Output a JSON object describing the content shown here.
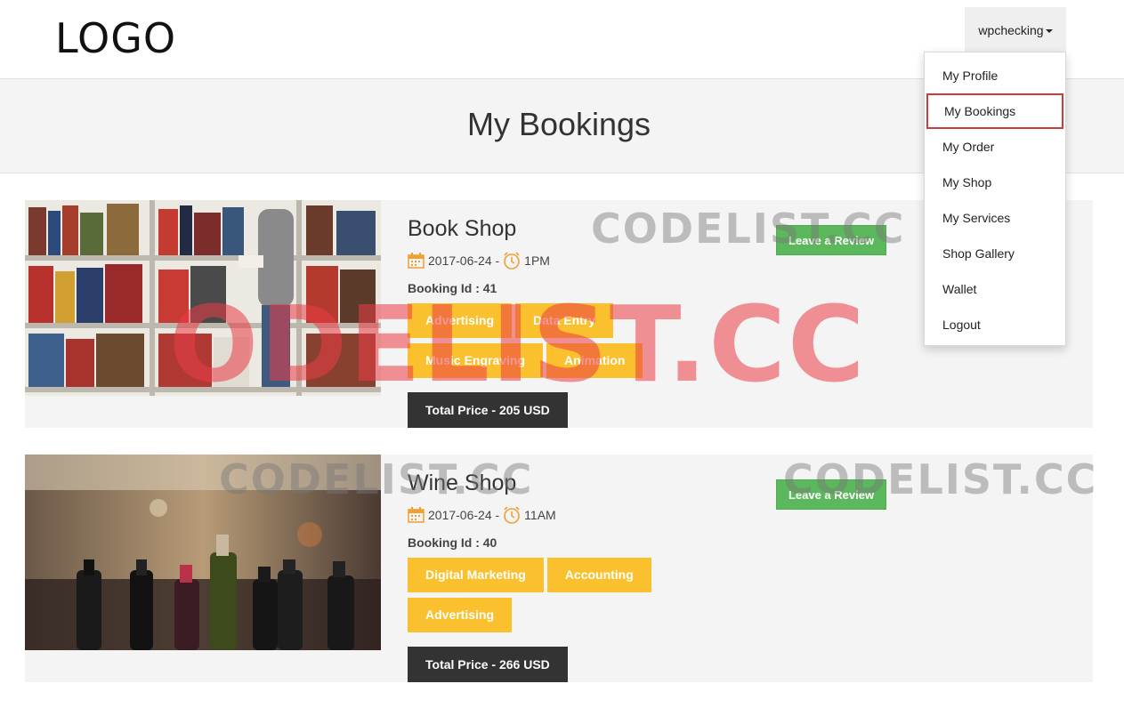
{
  "header": {
    "logo_text": "LOGO",
    "username": "wpchecking"
  },
  "page": {
    "title": "My Bookings"
  },
  "dropdown": {
    "items": [
      {
        "label": "My Profile"
      },
      {
        "label": "My Bookings"
      },
      {
        "label": "My Order"
      },
      {
        "label": "My Shop"
      },
      {
        "label": "My Services"
      },
      {
        "label": "Shop Gallery"
      },
      {
        "label": "Wallet"
      },
      {
        "label": "Logout"
      }
    ],
    "active": "My Bookings"
  },
  "bookings": [
    {
      "shop": "Book Shop",
      "date": "2017-06-24 -",
      "time": "1PM",
      "booking_id": "Booking Id : 41",
      "tags": [
        "Advertising",
        "Data Entry",
        "Music Engraving",
        "Animation"
      ],
      "total": "Total Price - 205 USD",
      "review_label": "Leave a Review"
    },
    {
      "shop": "Wine Shop",
      "date": "2017-06-24 -",
      "time": "11AM",
      "booking_id": "Booking Id : 40",
      "tags": [
        "Digital Marketing",
        "Accounting",
        "Advertising"
      ],
      "total": "Total Price - 266 USD",
      "review_label": "Leave a Review"
    }
  ],
  "watermark": {
    "text": "CODELIST.CC",
    "big_text": "ODELIST.CC"
  },
  "colors": {
    "tag": "#fbc02d",
    "review": "#5cb85c",
    "total": "#333333",
    "active_outline": "#d13a3a",
    "icon_orange": "#f0a030"
  },
  "icons": {
    "date": "calendar-icon",
    "time": "clock-icon",
    "caret": "caret-down-icon"
  }
}
